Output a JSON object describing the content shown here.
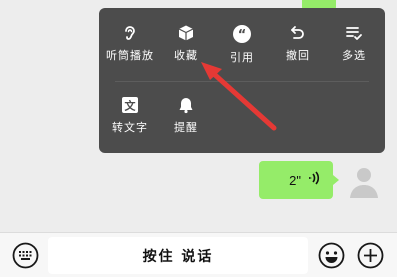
{
  "context_menu": {
    "items_row1": [
      {
        "label": "听筒播放",
        "icon": "ear-icon"
      },
      {
        "label": "收藏",
        "icon": "cube-icon"
      },
      {
        "label": "引用",
        "icon": "quote-icon"
      },
      {
        "label": "撤回",
        "icon": "undo-icon"
      },
      {
        "label": "多选",
        "icon": "multi-select-icon"
      }
    ],
    "items_row2": [
      {
        "label": "转文字",
        "icon": "text-convert-icon"
      },
      {
        "label": "提醒",
        "icon": "bell-icon"
      }
    ]
  },
  "message": {
    "duration": "2\"",
    "icon": "voice-wave-icon"
  },
  "input_bar": {
    "hold_to_talk": "按住 说话"
  },
  "colors": {
    "bubble_green": "#95ec69",
    "menu_bg": "#4c4c4c",
    "arrow_red": "#e53935"
  }
}
